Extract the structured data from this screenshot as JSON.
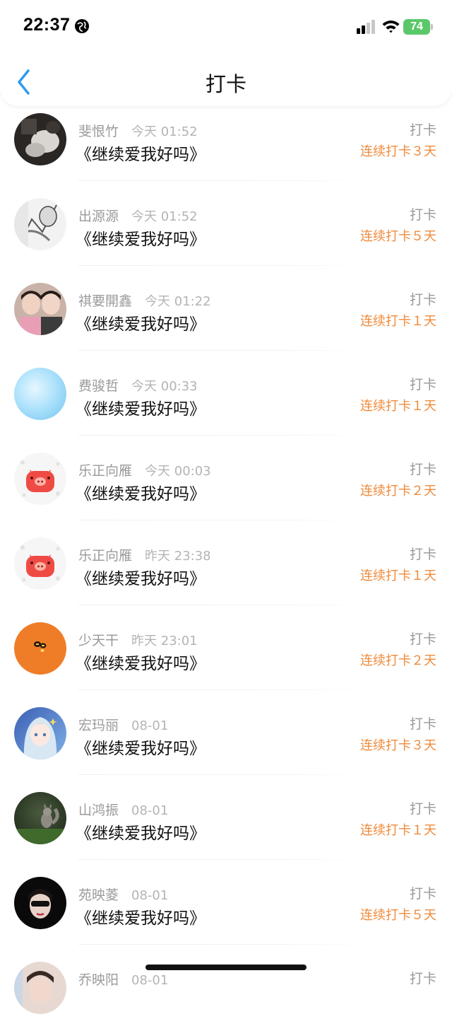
{
  "status_bar": {
    "time": "22:37",
    "battery": "74"
  },
  "header": {
    "title": "打卡"
  },
  "entries": [
    {
      "name": "斐恨竹",
      "time": "今天 01:52",
      "song": "《继续爱我好吗》",
      "action": "打卡",
      "streak": "连续打卡３天",
      "avatar": "photo-dark"
    },
    {
      "name": "出源源",
      "time": "今天 01:52",
      "song": "《继续爱我好吗》",
      "action": "打卡",
      "streak": "连续打卡５天",
      "avatar": "photo-sketch"
    },
    {
      "name": "祺要開鑫",
      "time": "今天 01:22",
      "song": "《继续爱我好吗》",
      "action": "打卡",
      "streak": "连续打卡１天",
      "avatar": "photo-two-people"
    },
    {
      "name": "费骏哲",
      "time": "今天 00:33",
      "song": "《继续爱我好吗》",
      "action": "打卡",
      "streak": "连续打卡１天",
      "avatar": "light-blue-gradient"
    },
    {
      "name": "乐正向雁",
      "time": "今天 00:03",
      "song": "《继续爱我好吗》",
      "action": "打卡",
      "streak": "连续打卡２天",
      "avatar": "red-pig"
    },
    {
      "name": "乐正向雁",
      "time": "昨天 23:38",
      "song": "《继续爱我好吗》",
      "action": "打卡",
      "streak": "连续打卡１天",
      "avatar": "red-pig"
    },
    {
      "name": "少天干",
      "time": "昨天 23:01",
      "song": "《继续爱我好吗》",
      "action": "打卡",
      "streak": "连续打卡２天",
      "avatar": "orange-bees"
    },
    {
      "name": "宏玛丽",
      "time": "08-01",
      "song": "《继续爱我好吗》",
      "action": "打卡",
      "streak": "连续打卡３天",
      "avatar": "anime-girl"
    },
    {
      "name": "山鸿振",
      "time": "08-01",
      "song": "《继续爱我好吗》",
      "action": "打卡",
      "streak": "连续打卡１天",
      "avatar": "squirrel"
    },
    {
      "name": "苑映菱",
      "time": "08-01",
      "song": "《继续爱我好吗》",
      "action": "打卡",
      "streak": "连续打卡５天",
      "avatar": "masked-face"
    },
    {
      "name": "乔映阳",
      "time": "08-01",
      "song": "",
      "action": "打卡",
      "streak": "",
      "avatar": "photo-partial"
    }
  ],
  "colors": {
    "streak": "#f08a3a",
    "back_arrow": "#2f9bec",
    "battery": "#5ac86a"
  }
}
